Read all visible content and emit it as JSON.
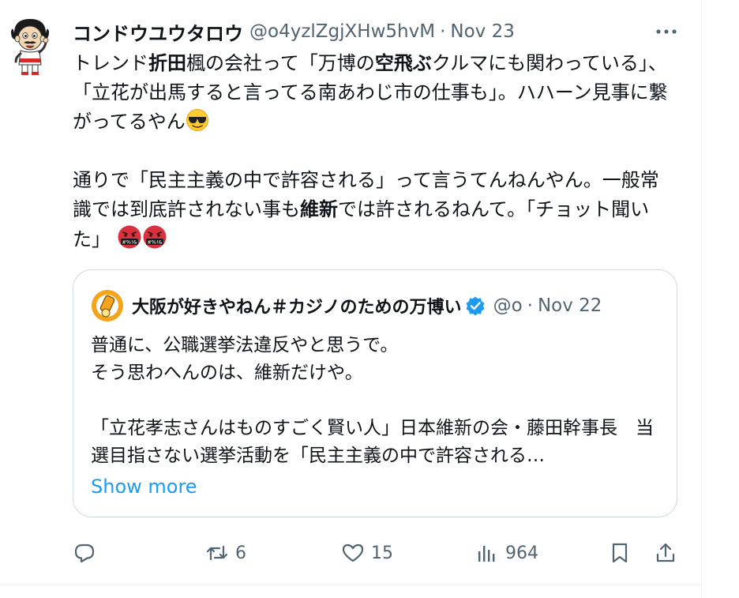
{
  "post": {
    "author_name": "コンドウユウタロウ",
    "author_handle": "@o4yzlZgjXHw5hvM",
    "separator": "·",
    "date": "Nov 23",
    "avatar_icon": "cartoon-man-avatar",
    "more_icon": "more-horizontal-icon",
    "text": {
      "p1_a": "トレンド",
      "p1_b": "折田",
      "p1_c": "楓の会社って「万博の",
      "p1_d": "空飛ぶ",
      "p1_e": "クルマにも関わっている」、「立花が出馬すると言ってる南あわじ市の仕事も」。ハハーン見事に繋がってるやん",
      "p2_a": "通りで「民主主義の中で許容される」って言うてんねんやん。一般常識では到底許されない事も",
      "p2_b": "維新",
      "p2_c": "では許されるねんて。「チョット聞いた」"
    },
    "emojis": [
      "sunglasses-emoji",
      "cursing-face-emoji",
      "cursing-face-emoji"
    ]
  },
  "quote": {
    "author_name": "大阪が好きやねん＃カジノのための万博い",
    "verified_icon": "verified-badge-icon",
    "author_handle": "@o",
    "separator": "·",
    "date": "Nov 22",
    "line1": "普通に、公職選挙法違反やと思うで。",
    "line2": "そう思わへんのは、維新だけや。",
    "line3": "「立花孝志さんはものすごく賢い人」日本維新の会・藤田幹事長　当選目指さない選挙活動を「民主主義の中で許容される…",
    "show_more": "Show more"
  },
  "actions": {
    "reply_count": "",
    "retweet_count": "6",
    "like_count": "15",
    "views_count": "964"
  },
  "colors": {
    "text": "#0f1419",
    "secondary": "#536471",
    "accent": "#1d9bf0",
    "border": "#cfd9de"
  }
}
